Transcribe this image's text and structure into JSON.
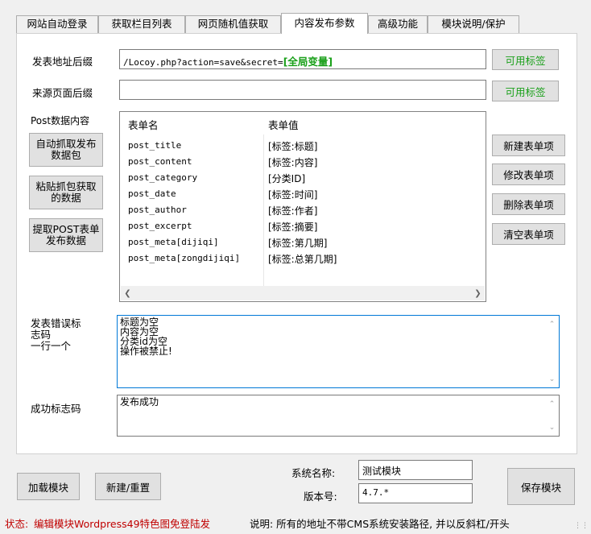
{
  "tabs": [
    {
      "label": "网站自动登录",
      "active": false
    },
    {
      "label": "获取栏目列表",
      "active": false
    },
    {
      "label": "网页随机值获取",
      "active": false
    },
    {
      "label": "内容发布参数",
      "active": true
    },
    {
      "label": "高级功能",
      "active": false
    },
    {
      "label": "模块说明/保护",
      "active": false
    }
  ],
  "publish": {
    "addr_label": "发表地址后缀",
    "addr_value": "/Locoy.php?action=save&secret=",
    "addr_variable": "[全局变量]",
    "source_label": "来源页面后缀",
    "source_value": "",
    "tags_button": "可用标签"
  },
  "post": {
    "label": "Post数据内容",
    "btn_auto_capture": "自动抓取发布数据包",
    "btn_paste_capture": "粘贴抓包获取的数据",
    "btn_extract_post": "提取POST表单发布数据",
    "headers": [
      "表单名",
      "表单值"
    ],
    "rows": [
      [
        "post_title",
        "[标签:标题]"
      ],
      [
        "post_content",
        "[标签:内容]"
      ],
      [
        "post_category",
        "[分类ID]"
      ],
      [
        "post_date",
        "[标签:时间]"
      ],
      [
        "post_author",
        "[标签:作者]"
      ],
      [
        "post_excerpt",
        "[标签:摘要]"
      ],
      [
        "post_meta[dijiqi]",
        "[标签:第几期]"
      ],
      [
        "post_meta[zongdijiqi]",
        "[标签:总第几期]"
      ]
    ],
    "btn_new": "新建表单项",
    "btn_edit": "修改表单项",
    "btn_delete": "删除表单项",
    "btn_clear": "清空表单项"
  },
  "error": {
    "label_lines": [
      "发表错误标",
      "志码",
      "一行一个"
    ],
    "lines": [
      "标题为空",
      "内容为空",
      "分类id为空",
      "操作被禁止!"
    ]
  },
  "success": {
    "label": "成功标志码",
    "value": "发布成功"
  },
  "footer": {
    "btn_load": "加载模块",
    "btn_new_reset": "新建/重置",
    "system_name_label": "系统名称:",
    "system_name_value": "测试模块",
    "version_label": "版本号:",
    "version_value": "4.7.*",
    "btn_save": "保存模块"
  },
  "status": {
    "prefix": "状态: ",
    "message": "编辑模块Wordpress49特色图免登陆发",
    "note": "说明: 所有的地址不带CMS系统安装路径, 并以反斜杠/开头"
  },
  "colors": {
    "accent_green": "#1aa01a",
    "status_red": "#c00000",
    "focus_blue": "#0078d7"
  }
}
